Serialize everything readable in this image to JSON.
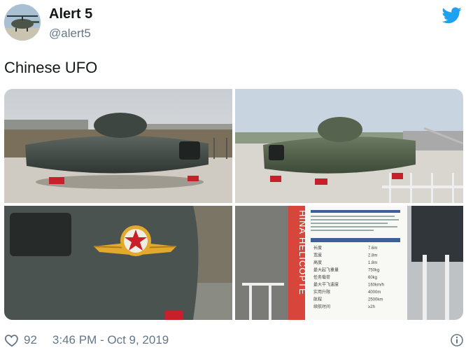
{
  "tweet": {
    "display_name": "Alert 5",
    "handle": "@alert5",
    "text": "Chinese UFO",
    "like_count": "92",
    "timestamp": "3:46 PM - Oct 9, 2019"
  },
  "media": {
    "placard_vertical_text": "HINA HELICOPTE",
    "placard_table_rows": [
      [
        "长度",
        "7.6m"
      ],
      [
        "宽度",
        "2.8m"
      ],
      [
        "高度",
        "1.8m"
      ],
      [
        "最大起飞重量",
        "750kg"
      ],
      [
        "任务载荷",
        "60kg"
      ],
      [
        "最大平飞速度",
        "160km/h"
      ],
      [
        "实用升限",
        "4000m"
      ],
      [
        "航程",
        "2500km"
      ],
      [
        "续航时间",
        "≥2h"
      ]
    ]
  },
  "icons": {
    "avatar": "helicopter-avatar",
    "brand": "twitter-bird-icon",
    "like": "heart-outline-icon",
    "info": "info-circle-icon"
  },
  "colors": {
    "twitter_blue": "#1da1f2",
    "secondary_text": "#657786",
    "primary_text": "#14171a"
  }
}
